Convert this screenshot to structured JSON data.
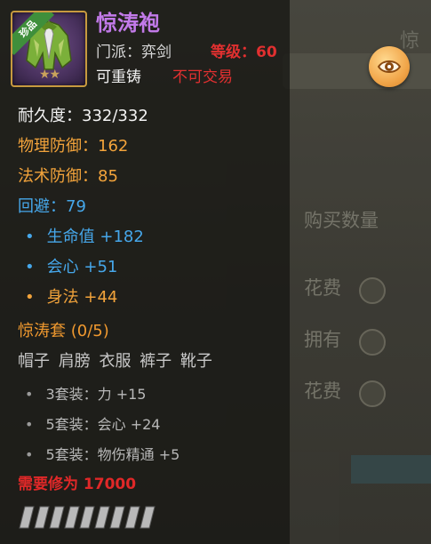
{
  "item": {
    "name": "惊涛袍",
    "rarity_badge": "珍品",
    "faction_label": "门派：",
    "faction_value": "弈剑",
    "level_label": "等级：",
    "level_value": "60",
    "recast": "可重铸",
    "no_exchange": "不可交易",
    "quality_stars": "★★",
    "icon": "green-robe-icon"
  },
  "stats": {
    "durability_label": "耐久度：",
    "durability_value": "332/332",
    "phys_def_label": "物理防御：",
    "phys_def_value": "162",
    "magic_def_label": "法术防御：",
    "magic_def_value": "85",
    "dodge_label": "回避：",
    "dodge_value": "79",
    "bonus": [
      {
        "label": "生命值",
        "value": "+182",
        "color": "blue"
      },
      {
        "label": "会心",
        "value": "+51",
        "color": "blue"
      },
      {
        "label": "身法",
        "value": "+44",
        "color": "orange"
      }
    ]
  },
  "set": {
    "title": "惊涛套 (0/5)",
    "pieces": "帽子 肩膀 衣服 裤子 靴子",
    "bonuses": [
      "3套装：力 +15",
      "5套装：会心 +24",
      "5套装：物伤精通 +5"
    ]
  },
  "requirement": "需要修为 17000",
  "gauge_segments": 9,
  "colors": {
    "name": "#c27ae9",
    "white": "#f3f3f3",
    "orange": "#f2a33b",
    "blue": "#46a7ea",
    "red": "#e23030",
    "frame_gold": "#c79a3f"
  },
  "background": {
    "top_right": "惊",
    "buy_quantity": "购买数量",
    "spend_1": "花费",
    "own": "拥有",
    "spend_2": "花费"
  }
}
